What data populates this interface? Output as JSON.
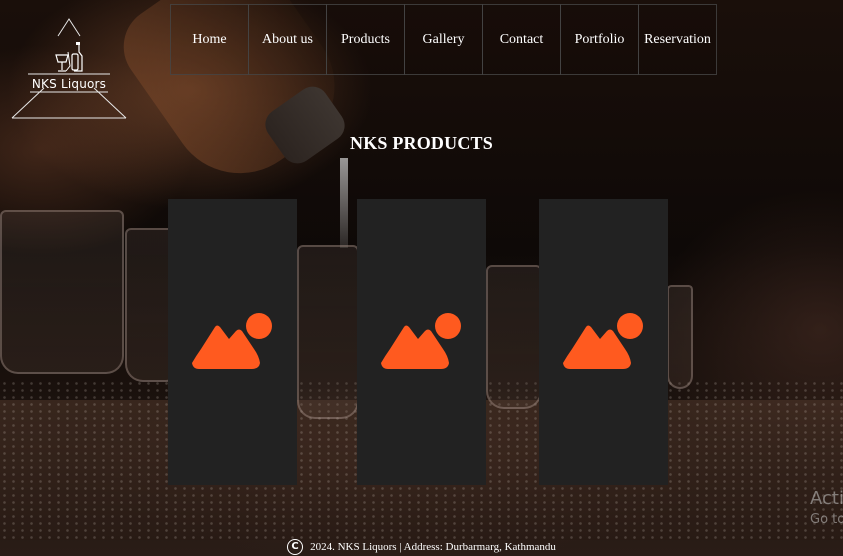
{
  "logo": {
    "text": "NKS Liquors"
  },
  "nav": {
    "items": [
      {
        "label": "Home"
      },
      {
        "label": "About us"
      },
      {
        "label": "Products"
      },
      {
        "label": "Gallery"
      },
      {
        "label": "Contact"
      },
      {
        "label": "Portfolio"
      },
      {
        "label": "Reservation"
      }
    ]
  },
  "products": {
    "title": "NKS PRODUCTS",
    "cards": [
      {
        "icon": "image-placeholder-icon"
      },
      {
        "icon": "image-placeholder-icon"
      },
      {
        "icon": "image-placeholder-icon"
      }
    ]
  },
  "footer": {
    "icon": "copyright-icon",
    "text": "2024. NKS Liquors | Address: Durbarmarg, Kathmandu"
  },
  "watermark": {
    "line1": "Acti",
    "line2": "Go to"
  },
  "colors": {
    "card_bg": "#222222",
    "icon_accent": "#ff5a1f",
    "text": "#ffffff"
  }
}
